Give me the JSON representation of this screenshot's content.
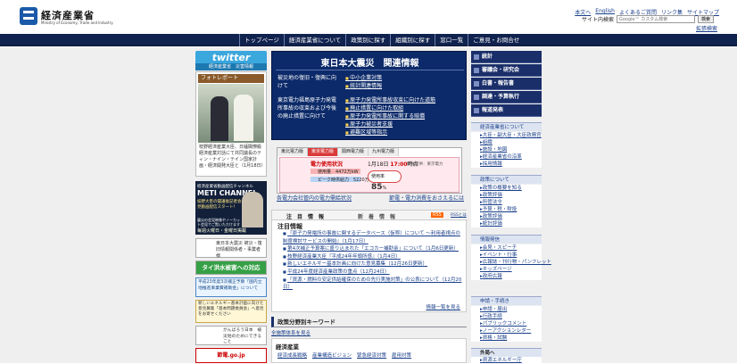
{
  "header": {
    "logo_name": "経済産業省",
    "logo_sub": "Ministry of Economy, Trade and Industry",
    "utility": [
      "本文へ",
      "English",
      "よくあるご質問",
      "リンク集",
      "サイトマップ"
    ],
    "search_label": "サイト内検索",
    "search_placeholder": "Google™ カスタム検索",
    "search_button": "検索",
    "advanced_search": "拡張検索"
  },
  "gnav": [
    "トップページ",
    "経済産業省について",
    "政策別に探す",
    "組織別に探す",
    "窓口一覧",
    "ご意見・お問合せ"
  ],
  "left": {
    "twitter": "twitter",
    "twitter_sub": "経済産業省　災害情報",
    "photo_title": "フォトレポート",
    "photo_caption": "枝野経済産業大臣、日緬閣僚級経済産業対話にて共同議長のティン・ナイン・テイン国家計画・経済開発大臣と（1月18日）",
    "meti_a": "経済産業省動画配信チャンネル",
    "meti_b": "METI CHANNEL",
    "meti_c": "枝野大臣の閣議後記者会見動画配信スタート！",
    "meti_d": "震災の会見映像やノーカット会見でご覧いただけます",
    "meti_e": "毎週火曜日・金曜日掲載",
    "b1": "東日本大震災 被災・復旧情報関係者・事業者様",
    "b2": "タイ洪水被害への対応",
    "b3": "平成23年度3次補正予算「国内立地推進事業費補助金」について",
    "b4": "新しいエネルギー基本計画に向けた意見募集「基本問題委員会」へ意見をお寄せください",
    "b5": "がんばろう日本　被災地のためにできること",
    "b6": "節電.go.jp"
  },
  "quake": {
    "title": "東日本大震災　関連情報",
    "l1": "被災地の復旧・復興に向けて",
    "l2": "東京電力福島原子力発電所事故の収束および今後の廃止措置に向けて",
    "links_a": [
      "中小企業対策",
      "統計関連情報"
    ],
    "links_b": [
      "原子力発電所事故収束に向けた道筋",
      "廃止措置に向けた取組",
      "原子力発電所事故に関する賠償",
      "原子力被災者支援",
      "避難区域等指示",
      "放射線計測値など"
    ]
  },
  "elec": {
    "tabs": [
      "東北電力版",
      "東京電力版",
      "関西電力版",
      "九州電力版"
    ],
    "title": "電力使用状況",
    "time_prefix": "1月18日",
    "time": "17:00",
    "time_suffix": "時点",
    "usage": "使用量　4472万kW",
    "supply": "ピーク時供給力　5220万kW",
    "pct_label": "使用率",
    "pct": "85",
    "pct_unit": "%",
    "note": "情報提供：東京電力",
    "link_left": "各電力会社管内の電力需給状況",
    "link_right": "節電・電力消費をおさえるには"
  },
  "news": {
    "tab1": "注　目　情　報",
    "tab2": "新　着　情　報",
    "rss": "RSS",
    "rss_help": "RSSとは",
    "heading": "注目情報",
    "items": [
      "『原子力発電所の事故に関するデータベース（仮称）について 〜利用者視点の制度検討サービスの開始』（1月17日）",
      "第4次補正予算案に盛り込まれた「エコカー補助金」について（1月6日更新）",
      "枝野経済産業大臣『平成24年年頭所感』（1月4日）",
      "新しいエネルギー基本計画に向けた意見募集（12月26日更新）",
      "平成24年度経済産業政策の重点（12月24日）",
      "「資源・燃料の安定供給確保のための先行実施対策」の公表について（12月20日）"
    ],
    "more": "情報一覧を見る"
  },
  "policy": {
    "title": "政策分野別キーワード",
    "sub": "全施策体系を見る",
    "econ_title": "経済産業",
    "econ_links": [
      "経済成長戦略",
      "産業構造ビジョン",
      "緊急経済対策",
      "雇用対策"
    ]
  },
  "right": {
    "blocks": [
      "統計",
      "審議会・研究会",
      "白書・報告書",
      "調達・予算執行",
      "報道発表"
    ],
    "about": "経済産業省について",
    "about_links": [
      "大臣・副大臣・大臣政務官",
      "組織",
      "施設・地図",
      "経済産業省の沿革",
      "採用情報"
    ],
    "policy": "政策について",
    "policy_links": [
      "政策の概要を知る",
      "政策評価",
      "所管法令",
      "予算・税・財投",
      "政策評価",
      "統計評価"
    ],
    "info": "情報発信",
    "info_links": [
      "会見・スピーチ",
      "イベント・行事",
      "広報誌・刊行物・パンフレット",
      "キッズページ",
      "政府広報"
    ],
    "apply": "申請・手続き",
    "apply_links": [
      "申請・届出",
      "行政手続",
      "パブリックコメント",
      "ノーアクションレター",
      "資格・試験"
    ],
    "ext": "外局へ",
    "ext_links": [
      "資源エネルギー庁"
    ]
  },
  "colors": {
    "nav": "#10224e",
    "accent": "#1a2f6a",
    "twitter": "#3aa7dd",
    "green": "#35a045",
    "red": "#d93a3a"
  }
}
